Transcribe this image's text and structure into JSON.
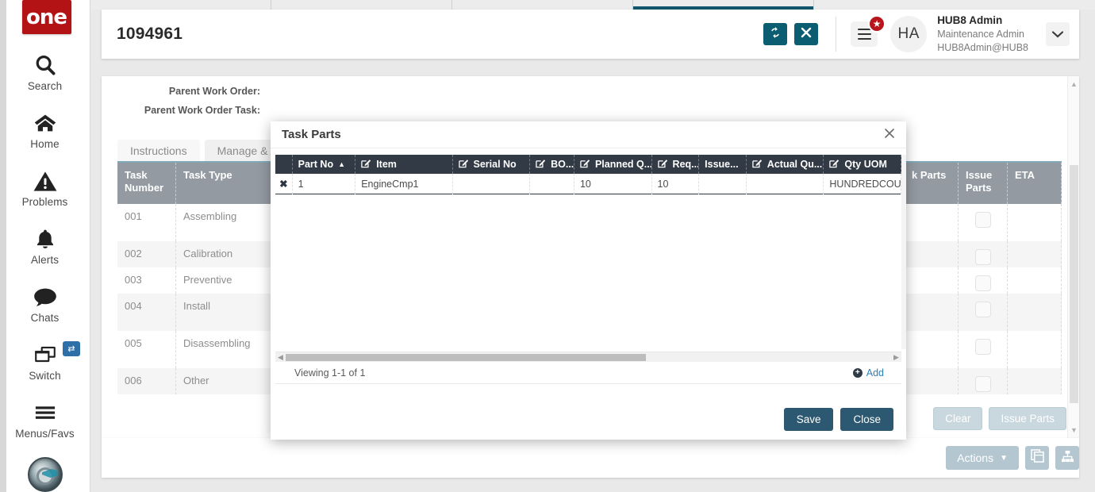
{
  "brand": {
    "logo_text": "one"
  },
  "sidebar": {
    "items": [
      {
        "label": "Search",
        "icon": "search-icon"
      },
      {
        "label": "Home",
        "icon": "home-icon"
      },
      {
        "label": "Problems",
        "icon": "warning-triangle-icon"
      },
      {
        "label": "Alerts",
        "icon": "bell-icon"
      },
      {
        "label": "Chats",
        "icon": "chat-bubble-icon"
      },
      {
        "label": "Switch",
        "icon": "windows-stack-icon",
        "badge_icon": "swap-arrows-icon"
      },
      {
        "label": "Menus/Favs",
        "icon": "hamburger-icon"
      }
    ],
    "assistant_icon": "ai-assistant-avatar-icon"
  },
  "header": {
    "title": "1094961",
    "refresh_icon": "refresh-icon",
    "close_icon": "close-x-icon",
    "menu_icon": "hamburger-menu-icon",
    "badge_icon": "star-badge-icon",
    "user": {
      "initials": "HA",
      "name": "HUB8 Admin",
      "role": "Maintenance Admin",
      "email": "HUB8Admin@HUB8"
    },
    "chevron_icon": "chevron-down-icon"
  },
  "content": {
    "meta": [
      "Parent Work Order:",
      "Parent Work Order Task:"
    ],
    "tabs": [
      {
        "label": "Instructions",
        "active": true
      },
      {
        "label": "Manage & Assign",
        "active": false
      }
    ],
    "task_grid": {
      "columns": [
        "Task Number",
        "Task Type",
        "",
        "k Parts",
        "Issue Parts",
        "ETA"
      ],
      "rows": [
        {
          "number": "001",
          "type": "Assembling"
        },
        {
          "number": "002",
          "type": "Calibration"
        },
        {
          "number": "003",
          "type": "Preventive"
        },
        {
          "number": "004",
          "type": "Install"
        },
        {
          "number": "005",
          "type": "Disassembling"
        },
        {
          "number": "006",
          "type": "Other"
        }
      ]
    },
    "footer_buttons": [
      {
        "label": "Clear",
        "disabled": true
      },
      {
        "label": "Issue Parts",
        "disabled": true
      }
    ]
  },
  "bottom_bar": {
    "actions_label": "Actions",
    "actions_caret_icon": "caret-down-icon",
    "copy_icon": "copy-stack-icon",
    "hierarchy_icon": "org-hierarchy-icon"
  },
  "modal": {
    "title": "Task Parts",
    "close_icon": "close-x-icon",
    "grid": {
      "columns": [
        {
          "label": "Part No",
          "editable": false,
          "sorted": "asc"
        },
        {
          "label": "Item",
          "editable": true
        },
        {
          "label": "Serial No",
          "editable": true
        },
        {
          "label": "BO...",
          "editable": true
        },
        {
          "label": "Planned Q...",
          "editable": true
        },
        {
          "label": "Req...",
          "editable": true
        },
        {
          "label": "Issue...",
          "editable": false
        },
        {
          "label": "Actual Qu...",
          "editable": true
        },
        {
          "label": "Qty UOM",
          "editable": true
        }
      ],
      "rows": [
        {
          "delete_icon": "delete-x-icon",
          "part_no": "1",
          "item": "EngineCmp1",
          "serial_no": "",
          "bo": "",
          "planned_qty": "10",
          "req_qty": "10",
          "issued": "",
          "actual_qty": "",
          "qty_uom": "HUNDREDCOU"
        }
      ]
    },
    "status_text": "Viewing 1-1 of 1",
    "add_label": "Add",
    "add_icon": "plus-circle-icon",
    "save_label": "Save",
    "close_label": "Close"
  },
  "colors": {
    "brand_red": "#b41316",
    "teal": "#0b5d72",
    "dark_header": "#323a45",
    "grid_header_gray": "#939aa1",
    "accent_blue": "#2f7fb5",
    "button_navy": "#2c5871",
    "disabled_blue_gray": "#b4c7d1",
    "active_tab_underline": "#11556e"
  }
}
